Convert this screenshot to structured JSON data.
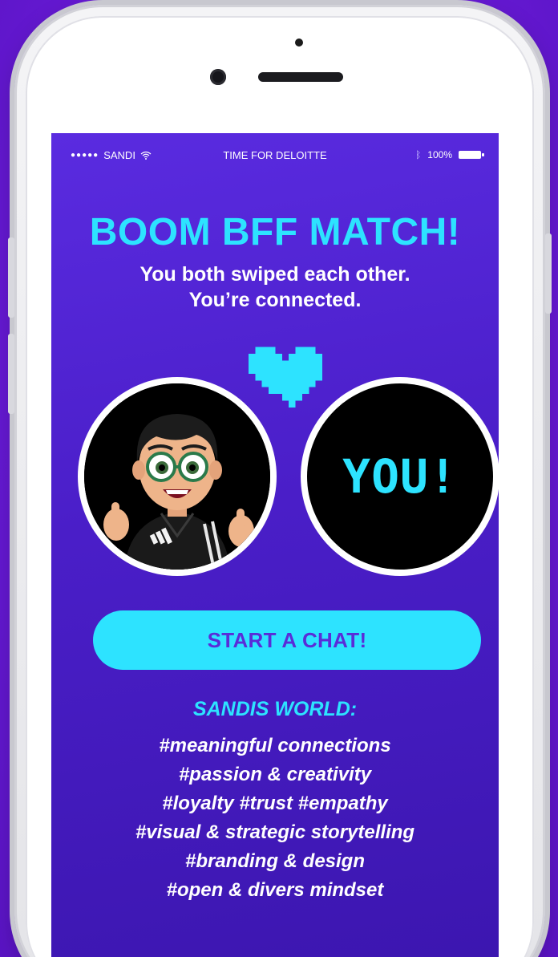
{
  "status_bar": {
    "carrier": "SANDI",
    "title": "TIME FOR DELOITTE",
    "battery": "100%"
  },
  "match": {
    "title": "BOOM BFF MATCH!",
    "subtitle_line1": "You both swiped each other.",
    "subtitle_line2": "You’re connected.",
    "you_label": "YOU!"
  },
  "chat_button": {
    "label": "START A CHAT!"
  },
  "world": {
    "title": "SANDIS WORLD:",
    "tags": [
      "#meaningful connections",
      "#passion & creativity",
      "#loyalty #trust #empathy",
      "#visual & strategic storytelling",
      "#branding & design",
      "#open & divers mindset"
    ]
  },
  "colors": {
    "accent": "#2de3ff",
    "screen_bg": "#4a1ec8",
    "page_bg": "#6a1bd8",
    "button_text": "#5a2cd8"
  },
  "icons": {
    "signal": "signal-dots-icon",
    "wifi": "wifi-icon",
    "bluetooth": "bluetooth-icon",
    "battery": "battery-icon",
    "heart": "pixel-heart-icon"
  }
}
